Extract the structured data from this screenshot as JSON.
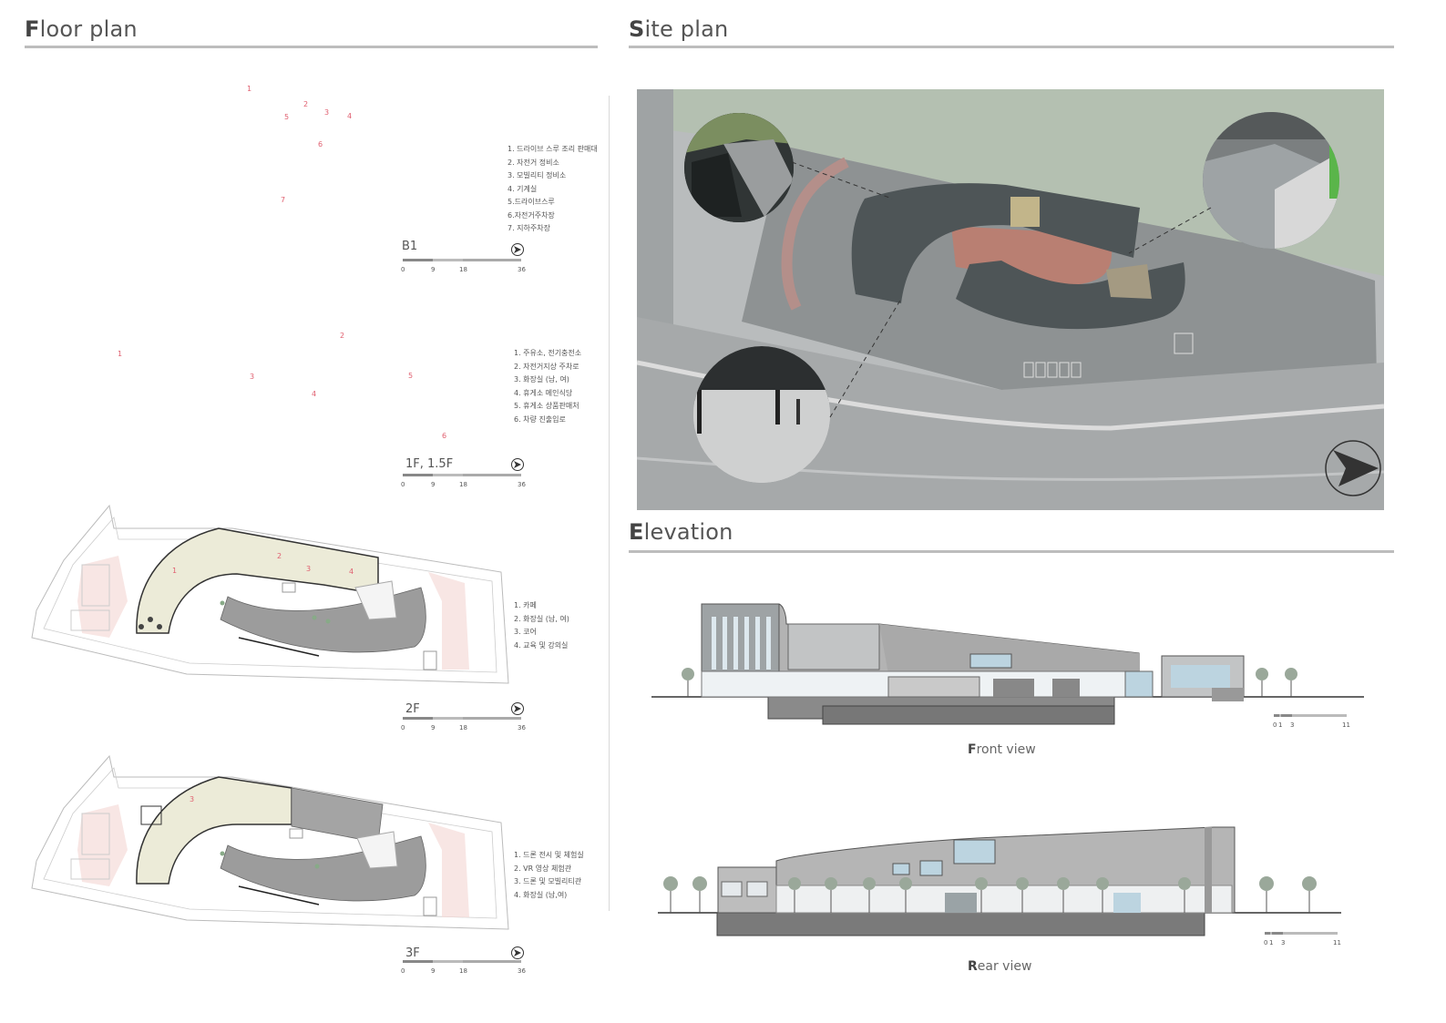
{
  "headings": {
    "floor_plan": {
      "first": "F",
      "rest": "loor plan"
    },
    "site_plan": {
      "first": "S",
      "rest": "ite plan"
    },
    "elevation": {
      "first": "E",
      "rest": "levation"
    }
  },
  "floors": {
    "b1": {
      "label": "B1",
      "numbers": [
        "1",
        "2",
        "3",
        "4",
        "5",
        "6",
        "7"
      ],
      "legend": [
        "1. 드라이브 스루 조리 판매대",
        "2. 자전거 정비소",
        "3. 모빌리티 정비소",
        "4. 기계실",
        "5.드라이브스루",
        "6.자전거주차장",
        "7. 지하주차장"
      ]
    },
    "f1": {
      "label": "1F, 1.5F",
      "numbers": [
        "1",
        "2",
        "3",
        "4",
        "5",
        "6"
      ],
      "legend": [
        "1. 주유소, 전기충전소",
        "2. 자전거지상 주차로",
        "3. 화장실 (남, 여)",
        "4. 휴게소 메인식당",
        "5. 휴게소 상품판매처",
        "6. 차량 진출입로"
      ]
    },
    "f2": {
      "label": "2F",
      "numbers": [
        "1",
        "2",
        "3",
        "4"
      ],
      "legend": [
        "1. 카페",
        "2. 화장실 (남, 여)",
        "3. 코어",
        "4. 교육 및 강의실"
      ]
    },
    "f3": {
      "label": "3F",
      "numbers": [
        "3"
      ],
      "legend": [
        "1. 드론 전시 및 체험실",
        "2. VR 영상 체험관",
        "3. 드론 및 모빌리티관",
        "4. 화장실 (남,여)"
      ]
    }
  },
  "floor_scale_ticks": [
    "0",
    "9",
    "18",
    "36"
  ],
  "elevation_scale_ticks": [
    "0",
    "1",
    "3",
    "11"
  ],
  "captions": {
    "front": {
      "first": "F",
      "rest": "ront view"
    },
    "rear": {
      "first": "R",
      "rest": "ear view"
    }
  },
  "colors": {
    "rule": "#bdbdbd",
    "number_red": "#e06070",
    "roof": "#4e5557",
    "plaza": "#c0877a",
    "facade_gray": "#a0a0a0",
    "glass": "#bcd4e0"
  }
}
